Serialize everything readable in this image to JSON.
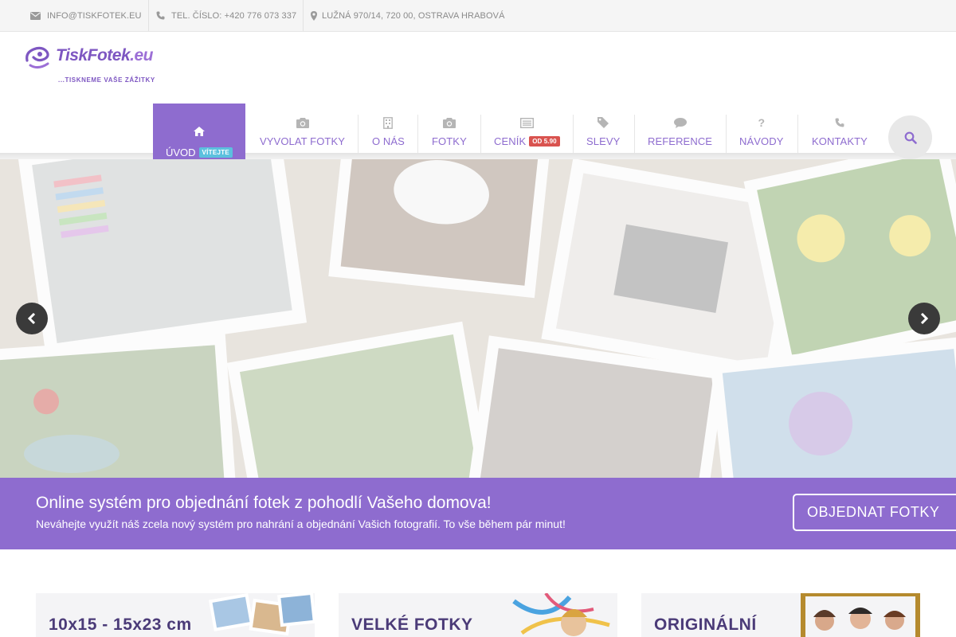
{
  "topbar": {
    "email": "INFO@TISKFOTEK.EU",
    "phone": "TEL. ČÍSLO: +420 776 073 337",
    "address": "LUŽNÁ 970/14, 720 00, OSTRAVA HRABOVÁ",
    "icons": [
      "envelope-icon",
      "phone-icon",
      "map-marker-icon"
    ]
  },
  "logo": {
    "name": "TiskFotek",
    "tld": ".eu",
    "tagline": "...TISKNEME VAŠE ZÁŽITKY"
  },
  "nav": {
    "home": {
      "label": "ÚVOD",
      "badge": "VÍTEJTE",
      "icon": "home-icon"
    },
    "items": [
      {
        "label": "VYVOLAT FOTKY",
        "icon": "camera-icon"
      },
      {
        "label": "O NÁS",
        "icon": "building-icon"
      },
      {
        "label": "FOTKY",
        "icon": "camera-icon"
      },
      {
        "label": "CENÍK",
        "badge": "OD 5.90",
        "icon": "list-icon"
      },
      {
        "label": "SLEVY",
        "icon": "tag-icon"
      },
      {
        "label": "REFERENCE",
        "icon": "comment-icon"
      },
      {
        "label": "NÁVODY",
        "icon": "question-icon"
      },
      {
        "label": "KONTAKTY",
        "icon": "phone-icon"
      }
    ],
    "search_icon": "search-icon"
  },
  "hero": {
    "prev_icon": "chevron-left-icon",
    "next_icon": "chevron-right-icon"
  },
  "band": {
    "title": "Online systém pro objednání fotek z pohodlí Vašeho domova!",
    "subtitle": "Neváhejte využít náš zcela nový systém pro nahrání a objednání Vašich fotografií. To vše během pár minut!",
    "cta": "OBJEDNAT FOTKY"
  },
  "cards": [
    {
      "title": "10x15 - 15x23 cm"
    },
    {
      "title": "VELKÉ FOTKY"
    },
    {
      "title": "ORIGINÁLNÍ"
    }
  ],
  "colors": {
    "accent": "#8e6ccf",
    "accent_dark": "#6c4fb0",
    "badge_blue": "#5bc0de",
    "badge_red": "#d9534f",
    "topbar_bg": "#f5f5f5"
  }
}
